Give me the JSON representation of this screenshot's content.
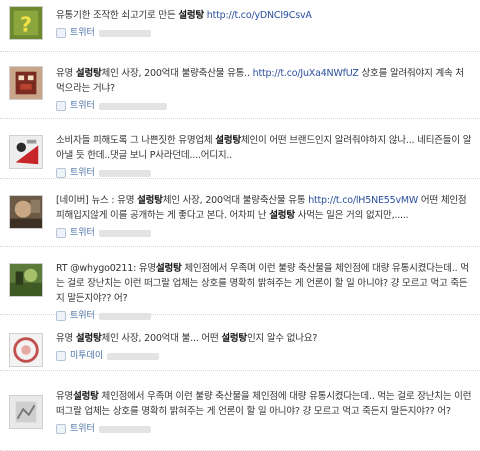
{
  "posts": [
    {
      "avatar": "question-mark-avatar",
      "segments": [
        {
          "t": "유통기한 조작한 쇠고기로 만든 ",
          "k": "text"
        },
        {
          "t": "설렁탕",
          "k": "kw"
        },
        {
          "t": " http://t.co/yDNCI9CsvA",
          "k": "link"
        }
      ],
      "source": "트위터"
    },
    {
      "avatar": "cartoon-avatar",
      "segments": [
        {
          "t": "유명 ",
          "k": "text"
        },
        {
          "t": "설렁탕",
          "k": "kw"
        },
        {
          "t": "체인 사장, 200억대 불량축산물 유통.. ",
          "k": "text"
        },
        {
          "t": "http://t.co/JuXa4NWfUZ",
          "k": "link"
        },
        {
          "t": " 상호를 알려줘야지 계속 처먹으라는 거냐?",
          "k": "text"
        }
      ],
      "source": "트위터"
    },
    {
      "avatar": "red-white-avatar",
      "segments": [
        {
          "t": "소비자들 피해도록 그 나쁜짓한 유명업체 ",
          "k": "text"
        },
        {
          "t": "설렁탕",
          "k": "kw"
        },
        {
          "t": "체인이 어떤 브랜드인지 알려줘야하지 않나... 네티즌들이 알아낼 듯 한데..댓글 보니 P사라던데....어디지..",
          "k": "text"
        }
      ],
      "source": "트위터"
    },
    {
      "avatar": "photo-avatar",
      "segments": [
        {
          "t": "[네이버] 뉴스 : 유명 ",
          "k": "text"
        },
        {
          "t": "설렁탕",
          "k": "kw"
        },
        {
          "t": "체인 사장, 200억대 불량축산물 유통 ",
          "k": "text"
        },
        {
          "t": "http://t.co/lH5NE55vMW",
          "k": "link"
        },
        {
          "t": " 어떤 체인점 피해입지않게 이를 공개하는 게 좋다고 본다. 어차피 난 ",
          "k": "text"
        },
        {
          "t": "설렁탕",
          "k": "kw"
        },
        {
          "t": " 사먹는 일은 거의 없지만,.....",
          "k": "text"
        }
      ],
      "source": "트위터"
    },
    {
      "avatar": "green-avatar",
      "segments": [
        {
          "t": "RT @whygo0211: 유명",
          "k": "text"
        },
        {
          "t": "설렁탕",
          "k": "kw"
        },
        {
          "t": " 체인점에서 우족며 이런 불량 축산물을 체인점에 대량 유통시켰다는데.. 먹는 걸로 장난치는 이런 떠그랄 업체는 상호를 명확히 밝혀주는 게 언론이 할 일 아니야? 걍 모르고 먹고 죽든지 말든지야?? 어?",
          "k": "text"
        }
      ],
      "source": "트위터"
    },
    {
      "avatar": "round-logo-avatar",
      "segments": [
        {
          "t": "유명 ",
          "k": "text"
        },
        {
          "t": "설렁탕",
          "k": "kw"
        },
        {
          "t": "체인 사장, 200억대 불... 어떤 ",
          "k": "text"
        },
        {
          "t": "설렁탕",
          "k": "kw"
        },
        {
          "t": "인지 알수 없나요?",
          "k": "text"
        }
      ],
      "source": "미투데이"
    },
    {
      "avatar": "sketch-avatar",
      "segments": [
        {
          "t": "유명",
          "k": "text"
        },
        {
          "t": "설렁탕",
          "k": "kw"
        },
        {
          "t": " 체인점에서 우족며 이런 불량 축산물을 체인점에 대량 유통시켰다는데.. 먹는 걸로 장난치는 이런 떠그랄 업체는 상호를 명확히 밝혀주는 게 언론이 할 일 아니야? 걍 모르고 먹고 죽든지 말든지야?? 어?",
          "k": "text"
        }
      ],
      "source": "트위터"
    }
  ]
}
